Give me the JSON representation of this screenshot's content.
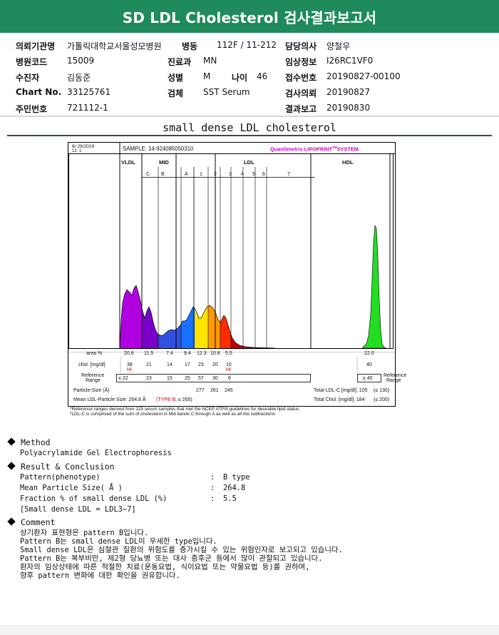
{
  "header": {
    "title": "SD LDL Cholesterol 검사결과보고서"
  },
  "info": {
    "rows": [
      {
        "l1": "의뢰기관명",
        "v1": "가톨릭대학교서울성모병원",
        "l2": "병동",
        "v2": "112F / 11-212",
        "l3": "",
        "v3": "",
        "l4": "담당의사",
        "v4": "양철우"
      },
      {
        "l1": "병원코드",
        "v1": "15009",
        "l2": "진료과",
        "v2": "MN",
        "l3": "",
        "v3": "",
        "l4": "임상정보",
        "v4": "I26RC1VF0"
      },
      {
        "l1": "수진자",
        "v1": "김동준",
        "l2": "성별",
        "v2": "M",
        "l3": "나이",
        "v3": "46",
        "l4": "접수번호",
        "v4": "20190827-00100"
      },
      {
        "l1": "Chart No.",
        "v1": "33125761",
        "l2": "검체",
        "v2": "SST Serum",
        "l3": "",
        "v3": "",
        "l4": "검사의뢰",
        "v4": "20190827"
      },
      {
        "l1": "주민번호",
        "v1": "721112-1",
        "l2": "",
        "v2": "",
        "l3": "",
        "v3": "",
        "l4": "결과보고",
        "v4": "20190830"
      }
    ]
  },
  "section_title": "small dense LDL cholesterol",
  "lipoprint": {
    "date": "8/ 29/2019",
    "date2": "12: 1",
    "sample": "SAMPLE:   14-924085050310",
    "brand": "Quantimetrix LIPOPRINT",
    "brand_tm": "TM",
    "brand_suffix": "SYSTEM",
    "groups": {
      "vldl": "VLDL",
      "mid": "MID",
      "ldl": "LDL",
      "hdl": "HDL"
    },
    "bands": [
      "C",
      "B",
      "A",
      "1",
      "2",
      "3",
      "4",
      "5",
      "6",
      "7"
    ],
    "rows": {
      "area_label": "area %",
      "area": [
        "20.8",
        "11.5",
        "7.4",
        "9.4",
        "12.3",
        "10.8",
        "5.5"
      ],
      "area_hdl": "22.0",
      "chol_label": "chol. [mg/dl]",
      "chol": [
        "38",
        "21",
        "14",
        "17",
        "23",
        "20",
        "10"
      ],
      "chol_hdl": "40",
      "hi1": "HI",
      "hi2": "HI",
      "ref_label1": "Reference",
      "ref_label2": "Range",
      "ref": [
        "≤ 22",
        "23",
        "15",
        "25",
        "57",
        "30",
        "6"
      ],
      "ref_hdl": "≥ 40",
      "ref_right1": "Reference",
      "ref_right2": "Range",
      "particle_label": "Particle-Size (Å)",
      "particle": [
        "277",
        "261",
        "245"
      ],
      "total_ldl_label": "Total LDL-C [mg/dl]: 105",
      "total_ldl_range": "(≤ 130)",
      "mean_label": "Mean LDL-Particle Size:   264.8 Å",
      "typeb": "(TYPE B",
      "typeb_suffix": "; ≤ 265)",
      "total_chol_label": "Total Chol. [mg/dl]:  184",
      "total_chol_range": "(≤ 200)"
    },
    "footnote": "*Reference ranges derived from 125 serum samples that met the NCEP ATPIII guidelines for desirable lipid status\n*LDL-C is comprised of the sum of cholesterol in Mid bands C through A as well as all the subfractions"
  },
  "method": {
    "heading": "Method",
    "text": "Polyacrylamide Gel Electrophoresis"
  },
  "result": {
    "heading": "Result & Conclusion",
    "lines": [
      {
        "k": "Pattern(phenotype)",
        "v": "B type"
      },
      {
        "k": "Mean Particle Size( Å )",
        "v": "264.8"
      },
      {
        "k": "Fraction % of small dense LDL (%)",
        "v": "5.5"
      }
    ],
    "note": "[Small dense LDL = LDL3~7]"
  },
  "comment": {
    "heading": "Comment",
    "lines": [
      "상기환자 표현형은 pattern B입니다.",
      "Pattern B는 small dense LDL이 우세한 type입니다.",
      "Small dense LDL은 심혈관 질환의 위험도를 증가시킬 수 있는 위험인자로 보고되고 있습니다.",
      "Pattern B는 복부비만, 제2형 당뇨병 또는 대사 증후군 등에서 많이 관찰되고 있습니다.",
      "환자의 임상상태에 따른 적절한 치료(운동요법, 식이요법 또는 약물요법 등)를 권하며,",
      "향후 pattern 변화에 대한 확인을 권유합니다."
    ]
  },
  "colors": {
    "header": "#1f8a5c",
    "brand": "#cc00cc",
    "hi": "#d00000"
  }
}
